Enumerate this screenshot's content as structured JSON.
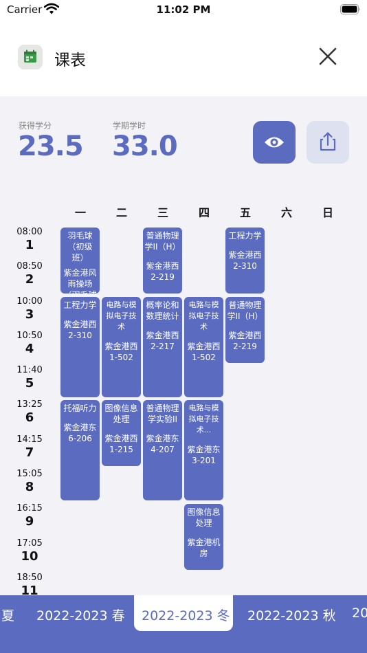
{
  "status": {
    "carrier": "Carrier",
    "time": "11:02 PM"
  },
  "header": {
    "title": "课表",
    "icon": "calendar-icon",
    "close_icon": "close-icon"
  },
  "stats": {
    "credits": {
      "label": "获得学分",
      "value": "23.5"
    },
    "hours": {
      "label": "学期学时",
      "value": "33.0"
    }
  },
  "actions": {
    "eye_icon": "eye-icon",
    "share_icon": "share-icon"
  },
  "days": [
    "一",
    "二",
    "三",
    "四",
    "五",
    "六",
    "日"
  ],
  "periods": [
    {
      "time": "08:00",
      "num": "1"
    },
    {
      "time": "08:50",
      "num": "2"
    },
    {
      "time": "10:00",
      "num": "3"
    },
    {
      "time": "10:50",
      "num": "4"
    },
    {
      "time": "11:40",
      "num": "5"
    },
    {
      "time": "13:25",
      "num": "6"
    },
    {
      "time": "14:15",
      "num": "7"
    },
    {
      "time": "15:05",
      "num": "8"
    },
    {
      "time": "16:15",
      "num": "9"
    },
    {
      "time": "17:05",
      "num": "10"
    },
    {
      "time": "18:50",
      "num": "11"
    }
  ],
  "courses": [
    {
      "day": 0,
      "start": 1,
      "span": 2,
      "name": "羽毛球（初级班）",
      "location": "紫金港风雨操场（羽毛球场）"
    },
    {
      "day": 0,
      "start": 3,
      "span": 3,
      "name": "工程力学",
      "location": "紫金港西2-310"
    },
    {
      "day": 0,
      "start": 6,
      "span": 3,
      "name": "托福听力",
      "location": "紫金港东6-206"
    },
    {
      "day": 1,
      "start": 3,
      "span": 3,
      "name": "电路与模拟电子技术",
      "location": "紫金港西1-502"
    },
    {
      "day": 1,
      "start": 6,
      "span": 2,
      "name": "图像信息处理",
      "location": "紫金港西1-215"
    },
    {
      "day": 2,
      "start": 1,
      "span": 2,
      "name": "普通物理学II（H）",
      "location": "紫金港西2-219"
    },
    {
      "day": 2,
      "start": 3,
      "span": 3,
      "name": "概率论和数理统计",
      "location": "紫金港西2-217"
    },
    {
      "day": 2,
      "start": 6,
      "span": 3,
      "name": "普通物理学实验II",
      "location": "紫金港东4-207"
    },
    {
      "day": 3,
      "start": 3,
      "span": 3,
      "name": "电路与模拟电子技术",
      "location": "紫金港西1-502"
    },
    {
      "day": 3,
      "start": 6,
      "span": 3,
      "name": "电路与模拟电子技术...",
      "location": "紫金港东3-201"
    },
    {
      "day": 3,
      "start": 9,
      "span": 2,
      "name": "图像信息处理",
      "location": "紫金港机房"
    },
    {
      "day": 4,
      "start": 1,
      "span": 2,
      "name": "工程力学",
      "location": "紫金港西2-310"
    },
    {
      "day": 4,
      "start": 3,
      "span": 2,
      "name": "普通物理学II（H）",
      "location": "紫金港西2-219"
    }
  ],
  "semesters": [
    {
      "label": "夏",
      "active": false
    },
    {
      "label": "2022-2023 春",
      "active": false
    },
    {
      "label": "2022-2023 冬",
      "active": true
    },
    {
      "label": "2022-2023 秋",
      "active": false
    },
    {
      "label": "20",
      "active": false
    }
  ],
  "colors": {
    "accent": "#5a6bc0",
    "accent_light": "#dde1f0"
  }
}
